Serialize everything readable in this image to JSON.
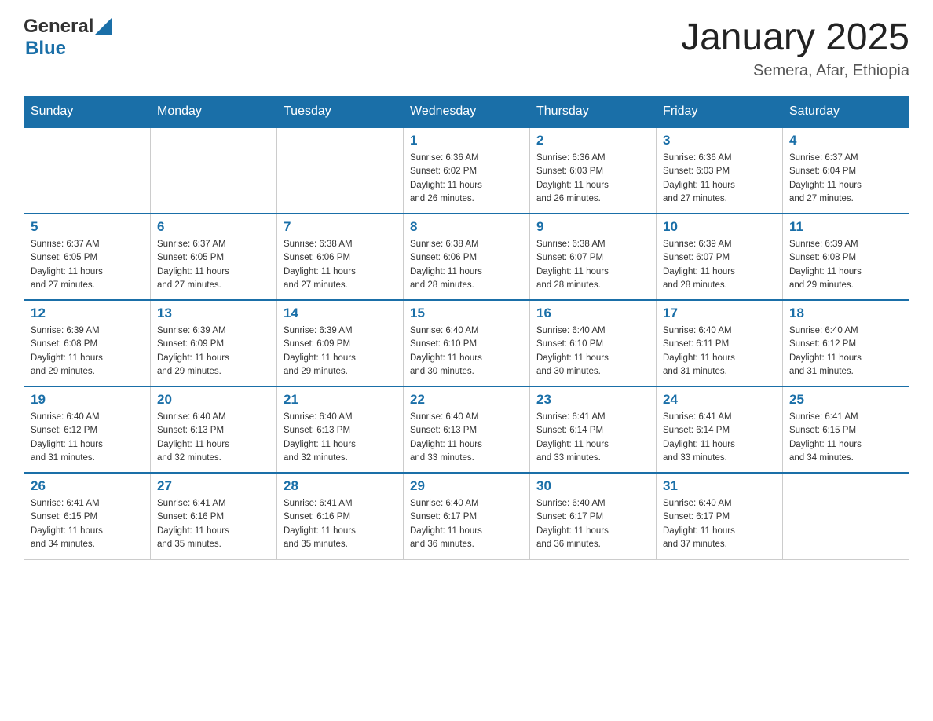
{
  "header": {
    "logo": {
      "general": "General",
      "blue": "Blue",
      "sub": "Blue"
    },
    "title": "January 2025",
    "location": "Semera, Afar, Ethiopia"
  },
  "days_of_week": [
    "Sunday",
    "Monday",
    "Tuesday",
    "Wednesday",
    "Thursday",
    "Friday",
    "Saturday"
  ],
  "weeks": [
    [
      {
        "day": "",
        "info": ""
      },
      {
        "day": "",
        "info": ""
      },
      {
        "day": "",
        "info": ""
      },
      {
        "day": "1",
        "info": "Sunrise: 6:36 AM\nSunset: 6:02 PM\nDaylight: 11 hours\nand 26 minutes."
      },
      {
        "day": "2",
        "info": "Sunrise: 6:36 AM\nSunset: 6:03 PM\nDaylight: 11 hours\nand 26 minutes."
      },
      {
        "day": "3",
        "info": "Sunrise: 6:36 AM\nSunset: 6:03 PM\nDaylight: 11 hours\nand 27 minutes."
      },
      {
        "day": "4",
        "info": "Sunrise: 6:37 AM\nSunset: 6:04 PM\nDaylight: 11 hours\nand 27 minutes."
      }
    ],
    [
      {
        "day": "5",
        "info": "Sunrise: 6:37 AM\nSunset: 6:05 PM\nDaylight: 11 hours\nand 27 minutes."
      },
      {
        "day": "6",
        "info": "Sunrise: 6:37 AM\nSunset: 6:05 PM\nDaylight: 11 hours\nand 27 minutes."
      },
      {
        "day": "7",
        "info": "Sunrise: 6:38 AM\nSunset: 6:06 PM\nDaylight: 11 hours\nand 27 minutes."
      },
      {
        "day": "8",
        "info": "Sunrise: 6:38 AM\nSunset: 6:06 PM\nDaylight: 11 hours\nand 28 minutes."
      },
      {
        "day": "9",
        "info": "Sunrise: 6:38 AM\nSunset: 6:07 PM\nDaylight: 11 hours\nand 28 minutes."
      },
      {
        "day": "10",
        "info": "Sunrise: 6:39 AM\nSunset: 6:07 PM\nDaylight: 11 hours\nand 28 minutes."
      },
      {
        "day": "11",
        "info": "Sunrise: 6:39 AM\nSunset: 6:08 PM\nDaylight: 11 hours\nand 29 minutes."
      }
    ],
    [
      {
        "day": "12",
        "info": "Sunrise: 6:39 AM\nSunset: 6:08 PM\nDaylight: 11 hours\nand 29 minutes."
      },
      {
        "day": "13",
        "info": "Sunrise: 6:39 AM\nSunset: 6:09 PM\nDaylight: 11 hours\nand 29 minutes."
      },
      {
        "day": "14",
        "info": "Sunrise: 6:39 AM\nSunset: 6:09 PM\nDaylight: 11 hours\nand 29 minutes."
      },
      {
        "day": "15",
        "info": "Sunrise: 6:40 AM\nSunset: 6:10 PM\nDaylight: 11 hours\nand 30 minutes."
      },
      {
        "day": "16",
        "info": "Sunrise: 6:40 AM\nSunset: 6:10 PM\nDaylight: 11 hours\nand 30 minutes."
      },
      {
        "day": "17",
        "info": "Sunrise: 6:40 AM\nSunset: 6:11 PM\nDaylight: 11 hours\nand 31 minutes."
      },
      {
        "day": "18",
        "info": "Sunrise: 6:40 AM\nSunset: 6:12 PM\nDaylight: 11 hours\nand 31 minutes."
      }
    ],
    [
      {
        "day": "19",
        "info": "Sunrise: 6:40 AM\nSunset: 6:12 PM\nDaylight: 11 hours\nand 31 minutes."
      },
      {
        "day": "20",
        "info": "Sunrise: 6:40 AM\nSunset: 6:13 PM\nDaylight: 11 hours\nand 32 minutes."
      },
      {
        "day": "21",
        "info": "Sunrise: 6:40 AM\nSunset: 6:13 PM\nDaylight: 11 hours\nand 32 minutes."
      },
      {
        "day": "22",
        "info": "Sunrise: 6:40 AM\nSunset: 6:13 PM\nDaylight: 11 hours\nand 33 minutes."
      },
      {
        "day": "23",
        "info": "Sunrise: 6:41 AM\nSunset: 6:14 PM\nDaylight: 11 hours\nand 33 minutes."
      },
      {
        "day": "24",
        "info": "Sunrise: 6:41 AM\nSunset: 6:14 PM\nDaylight: 11 hours\nand 33 minutes."
      },
      {
        "day": "25",
        "info": "Sunrise: 6:41 AM\nSunset: 6:15 PM\nDaylight: 11 hours\nand 34 minutes."
      }
    ],
    [
      {
        "day": "26",
        "info": "Sunrise: 6:41 AM\nSunset: 6:15 PM\nDaylight: 11 hours\nand 34 minutes."
      },
      {
        "day": "27",
        "info": "Sunrise: 6:41 AM\nSunset: 6:16 PM\nDaylight: 11 hours\nand 35 minutes."
      },
      {
        "day": "28",
        "info": "Sunrise: 6:41 AM\nSunset: 6:16 PM\nDaylight: 11 hours\nand 35 minutes."
      },
      {
        "day": "29",
        "info": "Sunrise: 6:40 AM\nSunset: 6:17 PM\nDaylight: 11 hours\nand 36 minutes."
      },
      {
        "day": "30",
        "info": "Sunrise: 6:40 AM\nSunset: 6:17 PM\nDaylight: 11 hours\nand 36 minutes."
      },
      {
        "day": "31",
        "info": "Sunrise: 6:40 AM\nSunset: 6:17 PM\nDaylight: 11 hours\nand 37 minutes."
      },
      {
        "day": "",
        "info": ""
      }
    ]
  ]
}
